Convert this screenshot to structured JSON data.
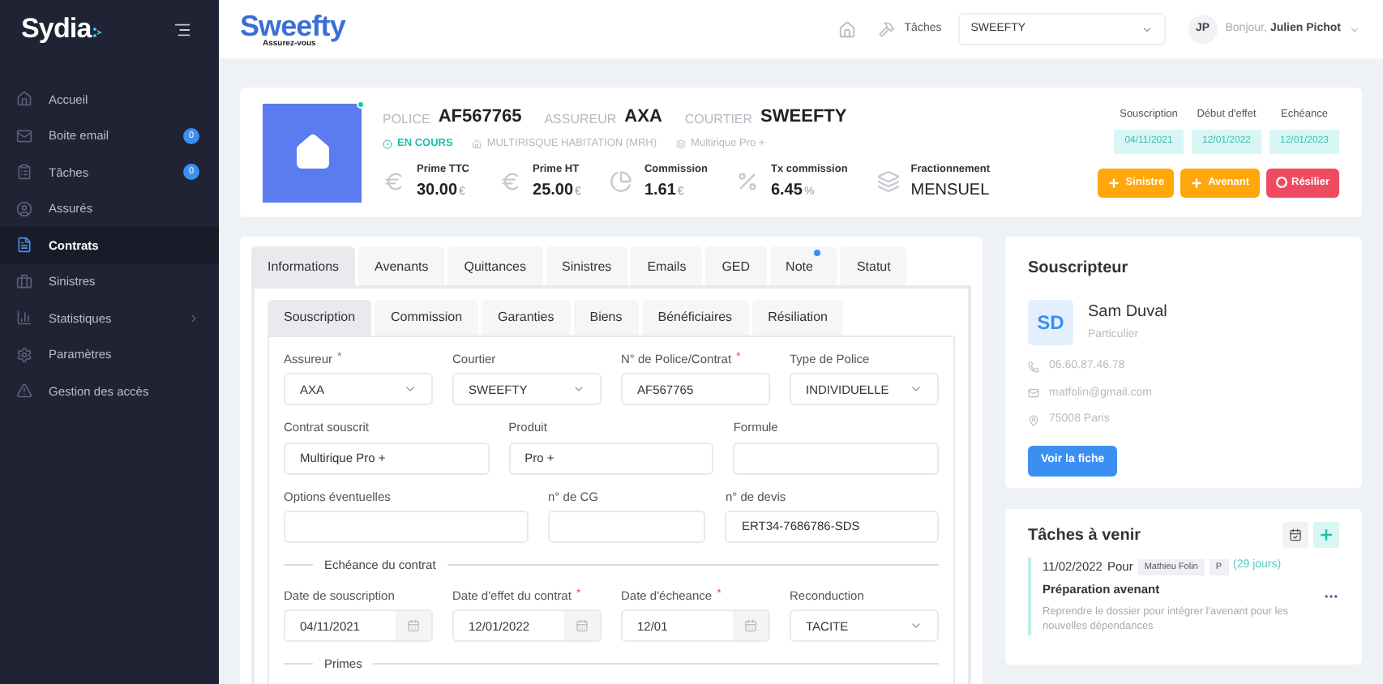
{
  "brand": {
    "name": "Sydia"
  },
  "sidebar": {
    "items": [
      {
        "label": "Accueil",
        "selected": false
      },
      {
        "label": "Boite email",
        "badge": "0",
        "selected": false
      },
      {
        "label": "Tâches",
        "badge": "0",
        "selected": false
      },
      {
        "label": "Assurés",
        "selected": false
      },
      {
        "label": "Contrats",
        "selected": true
      },
      {
        "label": "Sinistres",
        "selected": false
      },
      {
        "label": "Statistiques",
        "expandable": true,
        "selected": false
      },
      {
        "label": "Paramètres",
        "selected": false
      },
      {
        "label": "Gestion des accès",
        "selected": false
      }
    ]
  },
  "header": {
    "logo": "Sweefty",
    "tagline": "Assurez-vous",
    "tasks_link": "Tâches",
    "company_select": "SWEEFTY",
    "avatar": "JP",
    "greeting": "Bonjour,",
    "user": "Julien Pichot"
  },
  "policy": {
    "online": true,
    "fields": [
      {
        "label": "POLICE",
        "value": "AF567765"
      },
      {
        "label": "ASSUREUR",
        "value": "AXA"
      },
      {
        "label": "COURTIER",
        "value": "SWEEFTY"
      }
    ],
    "status": "EN COURS",
    "category": "MULTIRISQUE HABITATION (MRH)",
    "product": "Multirique Pro +",
    "stats": [
      {
        "label": "Prime TTC",
        "value": "30.00",
        "unit": "€"
      },
      {
        "label": "Prime HT",
        "value": "25.00",
        "unit": "€"
      },
      {
        "label": "Commission",
        "value": "1.61",
        "unit": "€"
      },
      {
        "label": "Tx commission",
        "value": "6.45",
        "unit": "%"
      },
      {
        "label": "Fractionnement",
        "value": "MENSUEL"
      }
    ],
    "dates": [
      {
        "label": "Souscription",
        "value": "04/11/2021"
      },
      {
        "label": "Début d'effet",
        "value": "12/01/2022"
      },
      {
        "label": "Echéance",
        "value": "12/01/2023"
      }
    ],
    "actions": [
      {
        "label": "Sinistre",
        "kind": "warning"
      },
      {
        "label": "Avenant",
        "kind": "warning"
      },
      {
        "label": "Résilier",
        "kind": "danger"
      }
    ]
  },
  "tabs": [
    {
      "label": "Informations",
      "selected": true,
      "dot": false
    },
    {
      "label": "Avenants",
      "selected": false,
      "dot": false
    },
    {
      "label": "Quittances",
      "selected": false,
      "dot": false
    },
    {
      "label": "Sinistres",
      "selected": false,
      "dot": false
    },
    {
      "label": "Emails",
      "selected": false,
      "dot": false
    },
    {
      "label": "GED",
      "selected": false,
      "dot": false
    },
    {
      "label": "Note",
      "selected": false,
      "dot": true
    },
    {
      "label": "Statut",
      "selected": false,
      "dot": false
    }
  ],
  "subtabs": [
    {
      "label": "Souscription",
      "selected": true
    },
    {
      "label": "Commission",
      "selected": false
    },
    {
      "label": "Garanties",
      "selected": false
    },
    {
      "label": "Biens",
      "selected": false
    },
    {
      "label": "Bénéficiaires",
      "selected": false
    },
    {
      "label": "Résiliation",
      "selected": false
    }
  ],
  "form": [
    {
      "kind": "row",
      "fields": [
        {
          "kind": "select",
          "label": "Assureur",
          "required_mark": "*",
          "value": "AXA"
        },
        {
          "kind": "select",
          "label": "Courtier",
          "value": "SWEEFTY"
        },
        {
          "kind": "input",
          "label": "N° de Police/Contrat",
          "required_mark": "*",
          "value": "AF567765"
        },
        {
          "kind": "select",
          "label": "Type de Police",
          "value": "INDIVIDUELLE"
        }
      ]
    },
    {
      "kind": "row",
      "fields": [
        {
          "kind": "input",
          "label": "Contrat souscrit",
          "value": "Multirique Pro +"
        },
        {
          "kind": "input",
          "label": "Produit",
          "value": "Pro +"
        },
        {
          "kind": "input",
          "label": "Formule"
        }
      ]
    },
    {
      "kind": "row",
      "fields": [
        {
          "kind": "input",
          "label": "Options éventuelles"
        },
        {
          "kind": "input",
          "label": "n° de CG"
        },
        {
          "kind": "input",
          "label": "n° de devis",
          "value": "ERT34-7686786-SDS"
        }
      ]
    },
    {
      "kind": "section",
      "title": "Echéance du contrat"
    },
    {
      "kind": "row",
      "fields": [
        {
          "kind": "date",
          "label": "Date de souscription",
          "value": "04/11/2021"
        },
        {
          "kind": "date",
          "label": "Date d'effet du contrat",
          "required_mark": "*",
          "value": "12/01/2022"
        },
        {
          "kind": "date",
          "label": "Date d'écheance",
          "required_mark": "*",
          "value": "12/01"
        },
        {
          "kind": "select",
          "label": "Reconduction",
          "value": "TACITE"
        }
      ]
    },
    {
      "kind": "section",
      "title": "Primes"
    }
  ],
  "subscriber": {
    "title": "Souscripteur",
    "initials": "SD",
    "name": "Sam Duval",
    "type": "Particulier",
    "contacts": [
      {
        "kind": "phone",
        "text": "06.60.87.46.78"
      },
      {
        "kind": "email",
        "text": "matfolin@gmail.com"
      },
      {
        "kind": "address",
        "text": "75008 Paris"
      }
    ],
    "button": "Voir la fiche"
  },
  "tasks": {
    "title": "Tâches à venir",
    "items": [
      {
        "date": "11/02/2022",
        "for": "Pour",
        "assignee": "Mathieu Folin",
        "priority": "P",
        "delay": "(29 jours)",
        "title": "Préparation avenant",
        "description": "Reprendre le dossier pour intégrer l'avenant pour les nouvelles dépendances"
      }
    ]
  }
}
